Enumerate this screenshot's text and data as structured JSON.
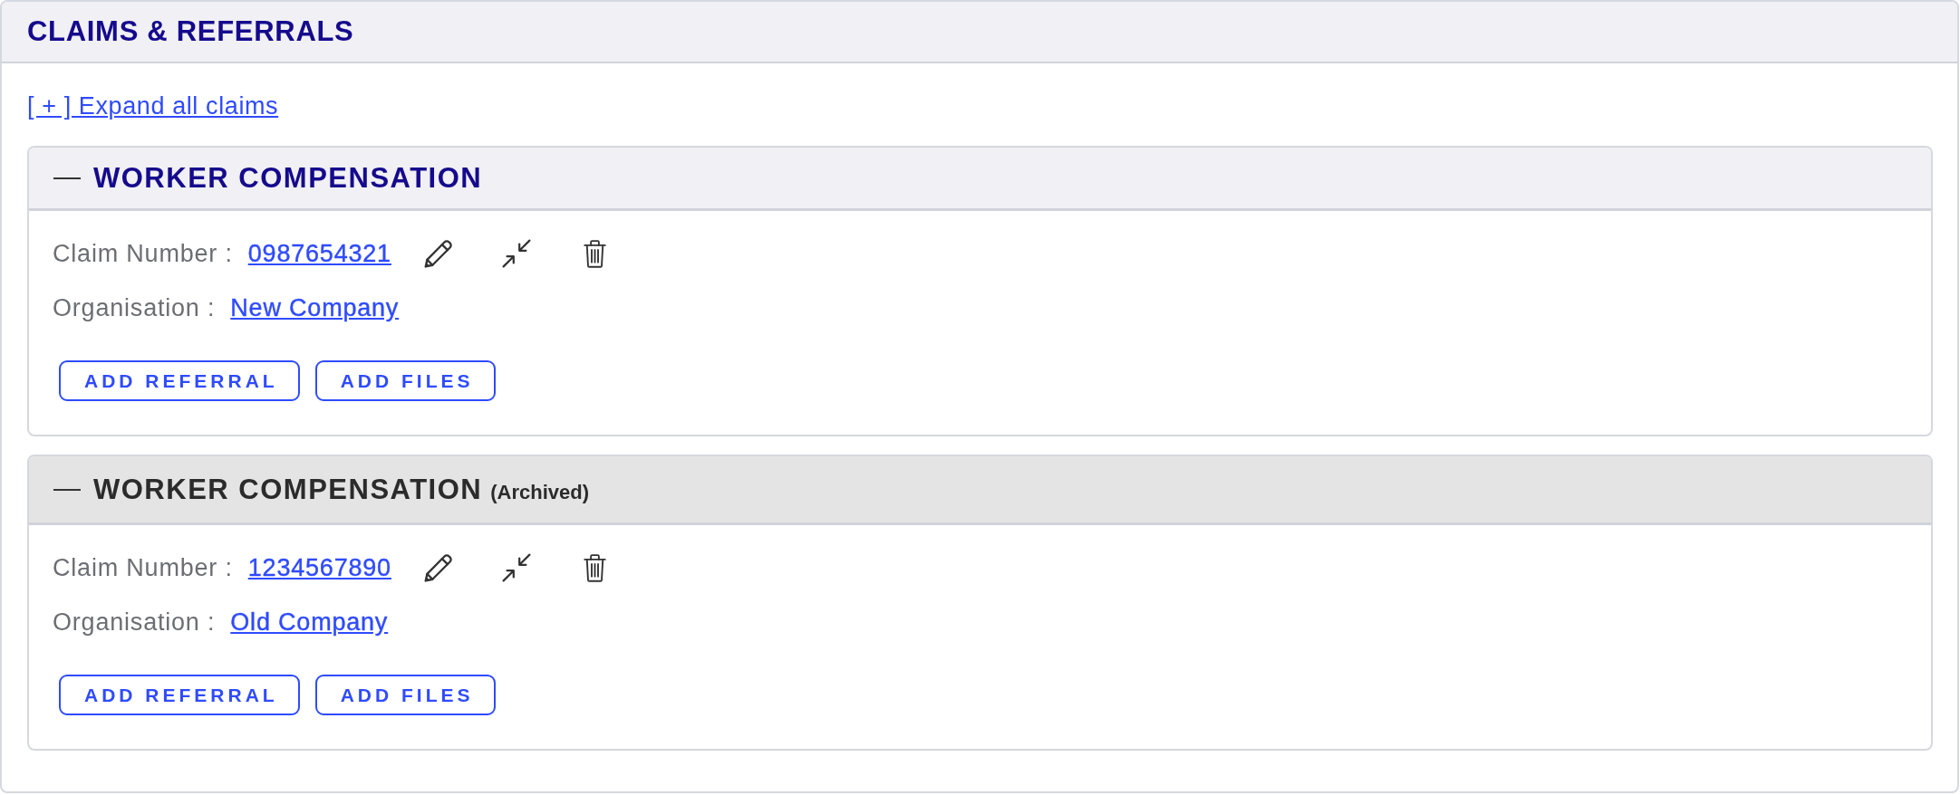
{
  "panel": {
    "title": "CLAIMS & REFERRALS"
  },
  "expand_all_link": "[ + ] Expand all claims",
  "claims": [
    {
      "title": "WORKER COMPENSATION",
      "expanded": true,
      "archived": false,
      "fields": [
        {
          "kind": "claim_number",
          "label": "Claim Number :",
          "value": "0987654321"
        },
        {
          "kind": "organisation",
          "label": "Organisation :",
          "value": "New Company"
        }
      ],
      "buttons": [
        "ADD REFERRAL",
        "ADD FILES"
      ]
    },
    {
      "title": "WORKER COMPENSATION",
      "status_note": "(Archived)",
      "expanded": true,
      "archived": true,
      "fields": [
        {
          "kind": "claim_number",
          "label": "Claim Number :",
          "value": "1234567890"
        },
        {
          "kind": "organisation",
          "label": "Organisation :",
          "value": "Old Company"
        }
      ],
      "buttons": [
        "ADD REFERRAL",
        "ADD FILES"
      ]
    }
  ]
}
